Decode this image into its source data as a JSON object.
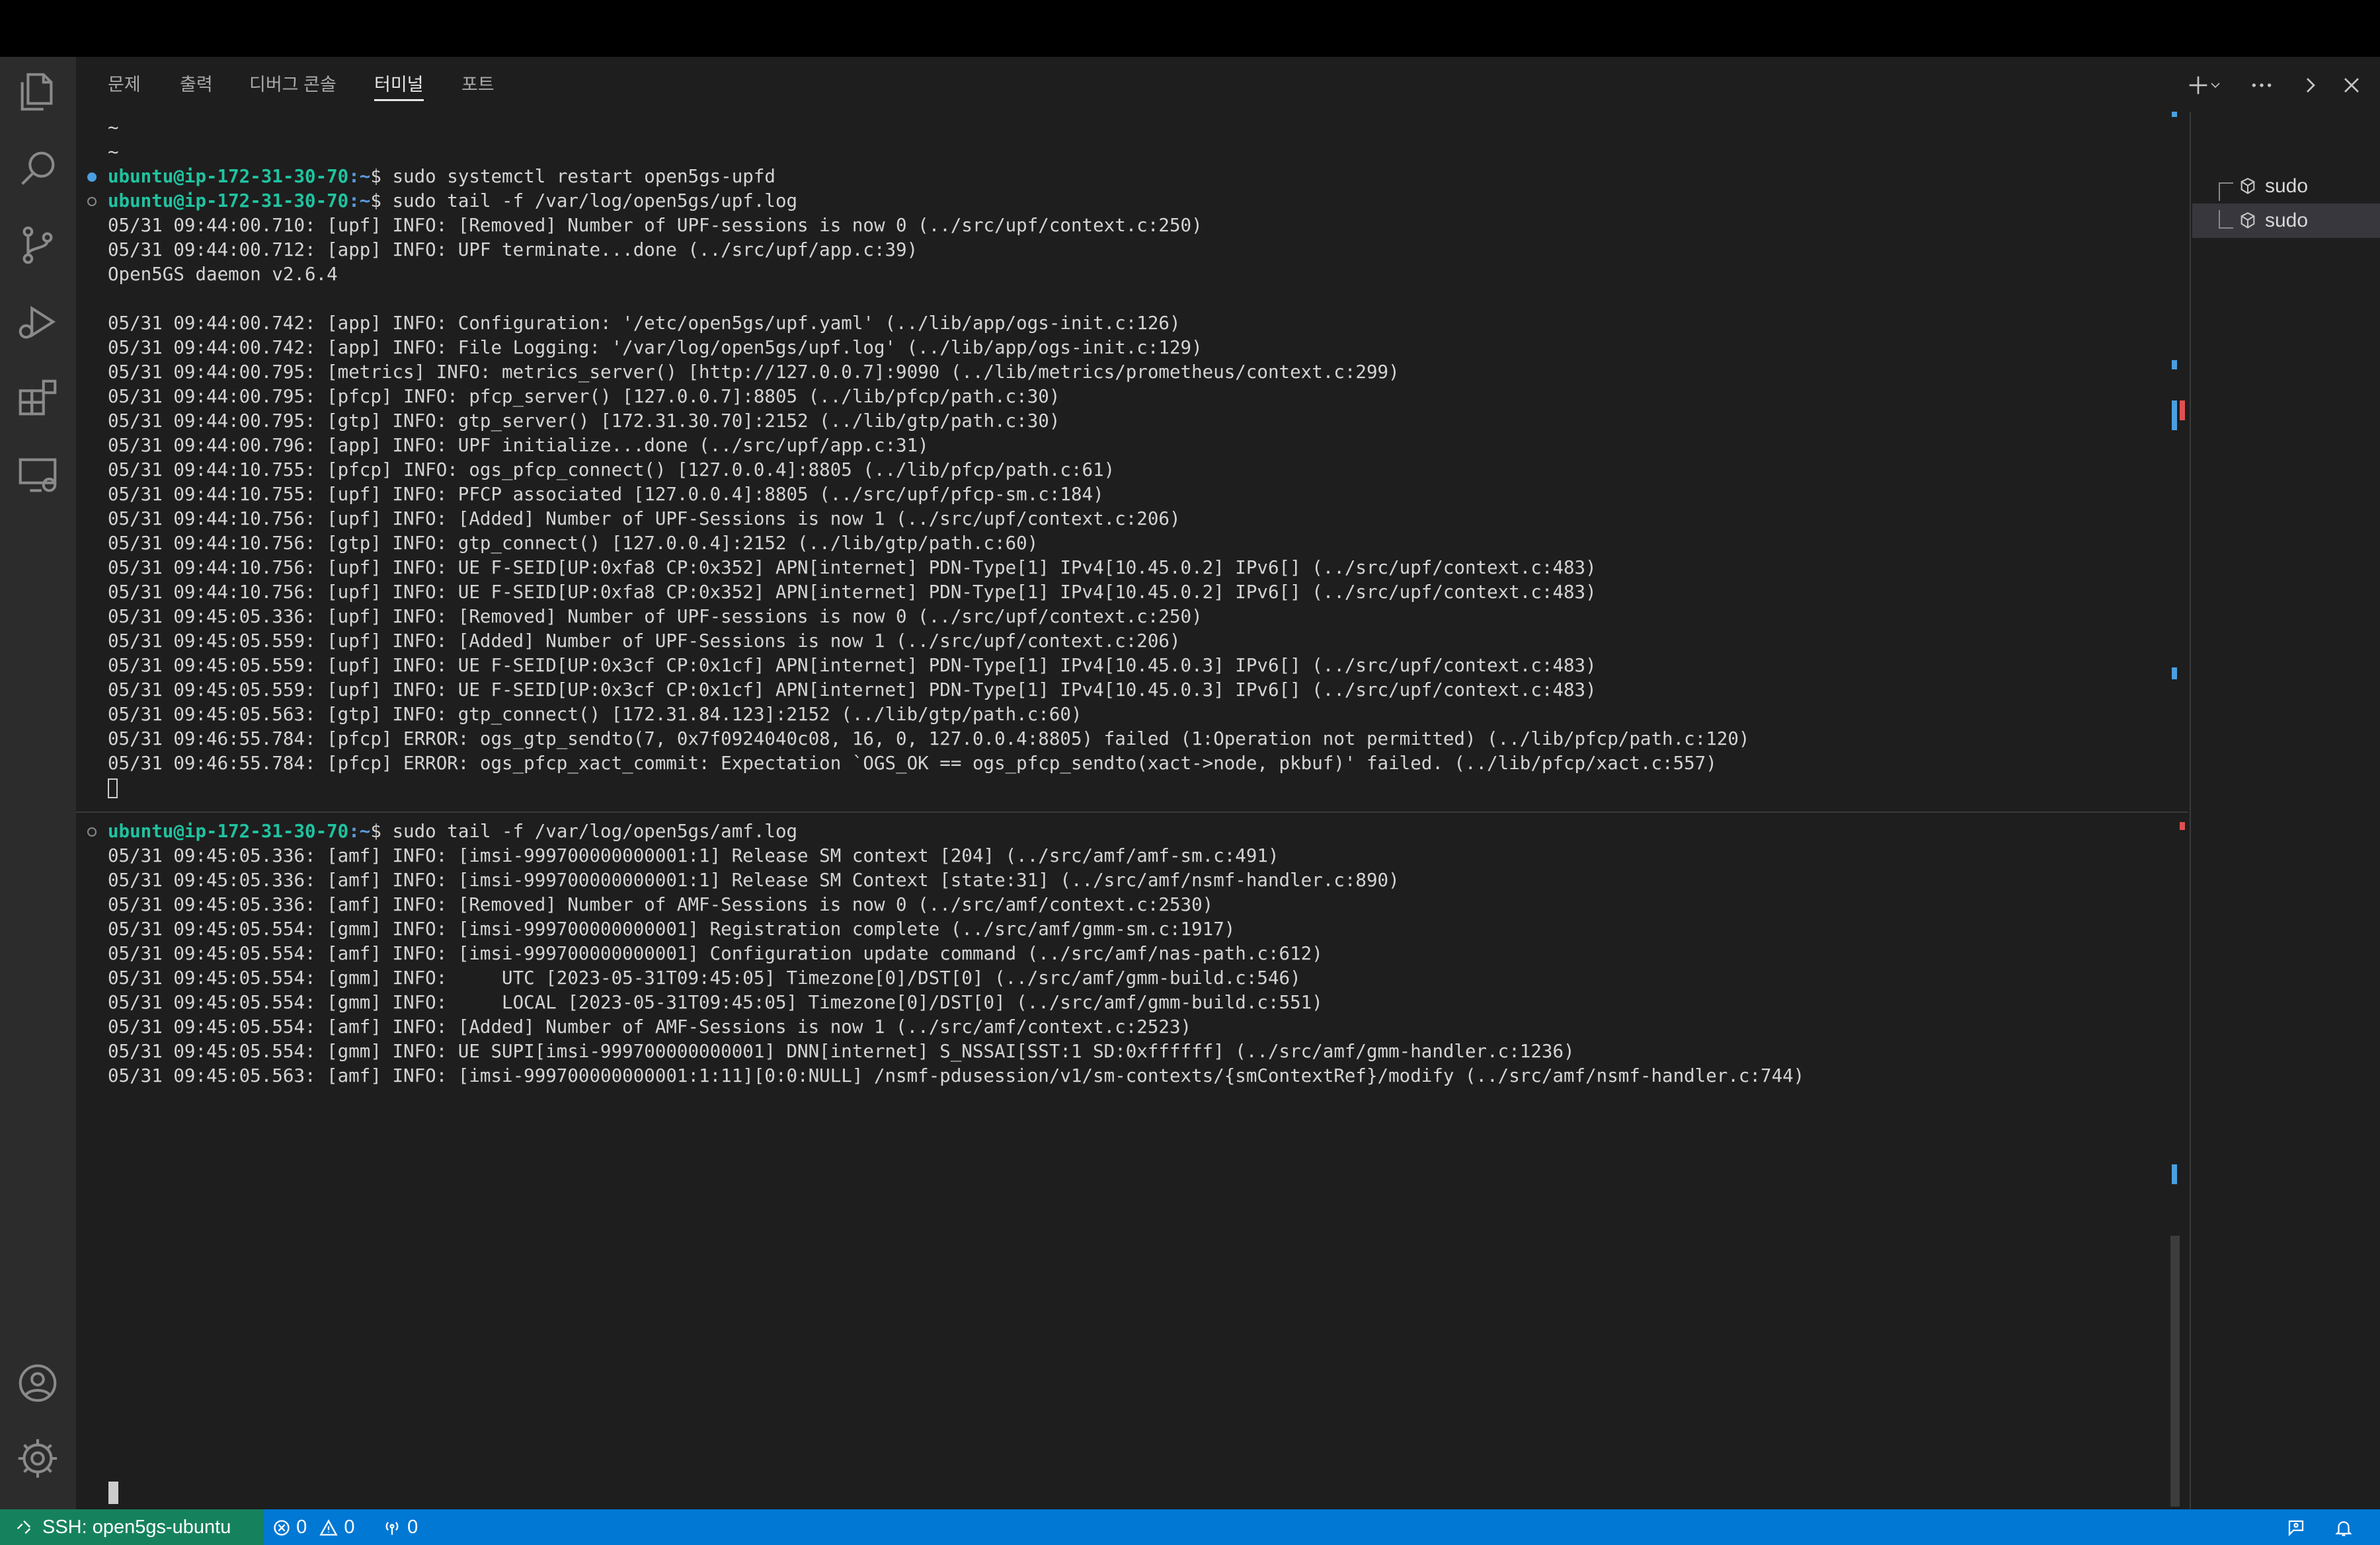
{
  "panel": {
    "tabs": [
      "문제",
      "출력",
      "디버그 콘솔",
      "터미널",
      "포트"
    ],
    "active_tab": "터미널"
  },
  "terminal_top": {
    "lines": [
      {
        "type": "text",
        "text": "~"
      },
      {
        "type": "text",
        "text": "~"
      },
      {
        "type": "prompt",
        "dot": "filled",
        "user": "ubuntu@ip-172-31-30-70",
        "path": ":~",
        "cmd": "$ sudo systemctl restart open5gs-upfd"
      },
      {
        "type": "prompt",
        "dot": "hollow",
        "user": "ubuntu@ip-172-31-30-70",
        "path": ":~",
        "cmd": "$ sudo tail -f /var/log/open5gs/upf.log"
      },
      {
        "type": "text",
        "text": "05/31 09:44:00.710: [upf] INFO: [Removed] Number of UPF-sessions is now 0 (../src/upf/context.c:250)"
      },
      {
        "type": "text",
        "text": "05/31 09:44:00.712: [app] INFO: UPF terminate...done (../src/upf/app.c:39)"
      },
      {
        "type": "text",
        "text": "Open5GS daemon v2.6.4"
      },
      {
        "type": "text",
        "text": ""
      },
      {
        "type": "text",
        "text": "05/31 09:44:00.742: [app] INFO: Configuration: '/etc/open5gs/upf.yaml' (../lib/app/ogs-init.c:126)"
      },
      {
        "type": "text",
        "text": "05/31 09:44:00.742: [app] INFO: File Logging: '/var/log/open5gs/upf.log' (../lib/app/ogs-init.c:129)"
      },
      {
        "type": "text",
        "text": "05/31 09:44:00.795: [metrics] INFO: metrics_server() [http://127.0.0.7]:9090 (../lib/metrics/prometheus/context.c:299)"
      },
      {
        "type": "text",
        "text": "05/31 09:44:00.795: [pfcp] INFO: pfcp_server() [127.0.0.7]:8805 (../lib/pfcp/path.c:30)"
      },
      {
        "type": "text",
        "text": "05/31 09:44:00.795: [gtp] INFO: gtp_server() [172.31.30.70]:2152 (../lib/gtp/path.c:30)"
      },
      {
        "type": "text",
        "text": "05/31 09:44:00.796: [app] INFO: UPF initialize...done (../src/upf/app.c:31)"
      },
      {
        "type": "text",
        "text": "05/31 09:44:10.755: [pfcp] INFO: ogs_pfcp_connect() [127.0.0.4]:8805 (../lib/pfcp/path.c:61)"
      },
      {
        "type": "text",
        "text": "05/31 09:44:10.755: [upf] INFO: PFCP associated [127.0.0.4]:8805 (../src/upf/pfcp-sm.c:184)"
      },
      {
        "type": "text",
        "text": "05/31 09:44:10.756: [upf] INFO: [Added] Number of UPF-Sessions is now 1 (../src/upf/context.c:206)"
      },
      {
        "type": "text",
        "text": "05/31 09:44:10.756: [gtp] INFO: gtp_connect() [127.0.0.4]:2152 (../lib/gtp/path.c:60)"
      },
      {
        "type": "text",
        "text": "05/31 09:44:10.756: [upf] INFO: UE F-SEID[UP:0xfa8 CP:0x352] APN[internet] PDN-Type[1] IPv4[10.45.0.2] IPv6[] (../src/upf/context.c:483)"
      },
      {
        "type": "text",
        "text": "05/31 09:44:10.756: [upf] INFO: UE F-SEID[UP:0xfa8 CP:0x352] APN[internet] PDN-Type[1] IPv4[10.45.0.2] IPv6[] (../src/upf/context.c:483)"
      },
      {
        "type": "text",
        "text": "05/31 09:45:05.336: [upf] INFO: [Removed] Number of UPF-sessions is now 0 (../src/upf/context.c:250)"
      },
      {
        "type": "text",
        "text": "05/31 09:45:05.559: [upf] INFO: [Added] Number of UPF-Sessions is now 1 (../src/upf/context.c:206)"
      },
      {
        "type": "text",
        "text": "05/31 09:45:05.559: [upf] INFO: UE F-SEID[UP:0x3cf CP:0x1cf] APN[internet] PDN-Type[1] IPv4[10.45.0.3] IPv6[] (../src/upf/context.c:483)"
      },
      {
        "type": "text",
        "text": "05/31 09:45:05.559: [upf] INFO: UE F-SEID[UP:0x3cf CP:0x1cf] APN[internet] PDN-Type[1] IPv4[10.45.0.3] IPv6[] (../src/upf/context.c:483)"
      },
      {
        "type": "text",
        "text": "05/31 09:45:05.563: [gtp] INFO: gtp_connect() [172.31.84.123]:2152 (../lib/gtp/path.c:60)"
      },
      {
        "type": "text",
        "text": "05/31 09:46:55.784: [pfcp] ERROR: ogs_gtp_sendto(7, 0x7f0924040c08, 16, 0, 127.0.0.4:8805) failed (1:Operation not permitted) (../lib/pfcp/path.c:120)"
      },
      {
        "type": "text",
        "text": "05/31 09:46:55.784: [pfcp] ERROR: ogs_pfcp_xact_commit: Expectation `OGS_OK == ogs_pfcp_sendto(xact->node, pkbuf)' failed. (../lib/pfcp/xact.c:557)"
      },
      {
        "type": "cursor"
      }
    ]
  },
  "terminal_bottom": {
    "lines": [
      {
        "type": "prompt",
        "dot": "hollow",
        "user": "ubuntu@ip-172-31-30-70",
        "path": ":~",
        "cmd": "$ sudo tail -f /var/log/open5gs/amf.log"
      },
      {
        "type": "text",
        "text": "05/31 09:45:05.336: [amf] INFO: [imsi-999700000000001:1] Release SM context [204] (../src/amf/amf-sm.c:491)"
      },
      {
        "type": "text",
        "text": "05/31 09:45:05.336: [amf] INFO: [imsi-999700000000001:1] Release SM Context [state:31] (../src/amf/nsmf-handler.c:890)"
      },
      {
        "type": "text",
        "text": "05/31 09:45:05.336: [amf] INFO: [Removed] Number of AMF-Sessions is now 0 (../src/amf/context.c:2530)"
      },
      {
        "type": "text",
        "text": "05/31 09:45:05.554: [gmm] INFO: [imsi-999700000000001] Registration complete (../src/amf/gmm-sm.c:1917)"
      },
      {
        "type": "text",
        "text": "05/31 09:45:05.554: [amf] INFO: [imsi-999700000000001] Configuration update command (../src/amf/nas-path.c:612)"
      },
      {
        "type": "text",
        "text": "05/31 09:45:05.554: [gmm] INFO:     UTC [2023-05-31T09:45:05] Timezone[0]/DST[0] (../src/amf/gmm-build.c:546)"
      },
      {
        "type": "text",
        "text": "05/31 09:45:05.554: [gmm] INFO:     LOCAL [2023-05-31T09:45:05] Timezone[0]/DST[0] (../src/amf/gmm-build.c:551)"
      },
      {
        "type": "text",
        "text": "05/31 09:45:05.554: [amf] INFO: [Added] Number of AMF-Sessions is now 1 (../src/amf/context.c:2523)"
      },
      {
        "type": "text",
        "text": "05/31 09:45:05.554: [gmm] INFO: UE SUPI[imsi-999700000000001] DNN[internet] S_NSSAI[SST:1 SD:0xffffff] (../src/amf/gmm-handler.c:1236)"
      },
      {
        "type": "text",
        "text": "05/31 09:45:05.563: [amf] INFO: [imsi-999700000000001:1:11][0:0:NULL] /nsmf-pdusession/v1/sm-contexts/{smContextRef}/modify (../src/amf/nsmf-handler.c:744)"
      }
    ]
  },
  "terminal_list": {
    "items": [
      {
        "label": "sudo",
        "selected": false
      },
      {
        "label": "sudo",
        "selected": true
      }
    ]
  },
  "status_bar": {
    "remote": "SSH: open5gs-ubuntu",
    "errors": "0",
    "warnings": "0",
    "ports": "0"
  },
  "colors": {
    "remote_bg": "#16825d",
    "status_bg": "#0078d4",
    "prompt_user": "#20c3a0",
    "prompt_path": "#5a9ce0"
  }
}
